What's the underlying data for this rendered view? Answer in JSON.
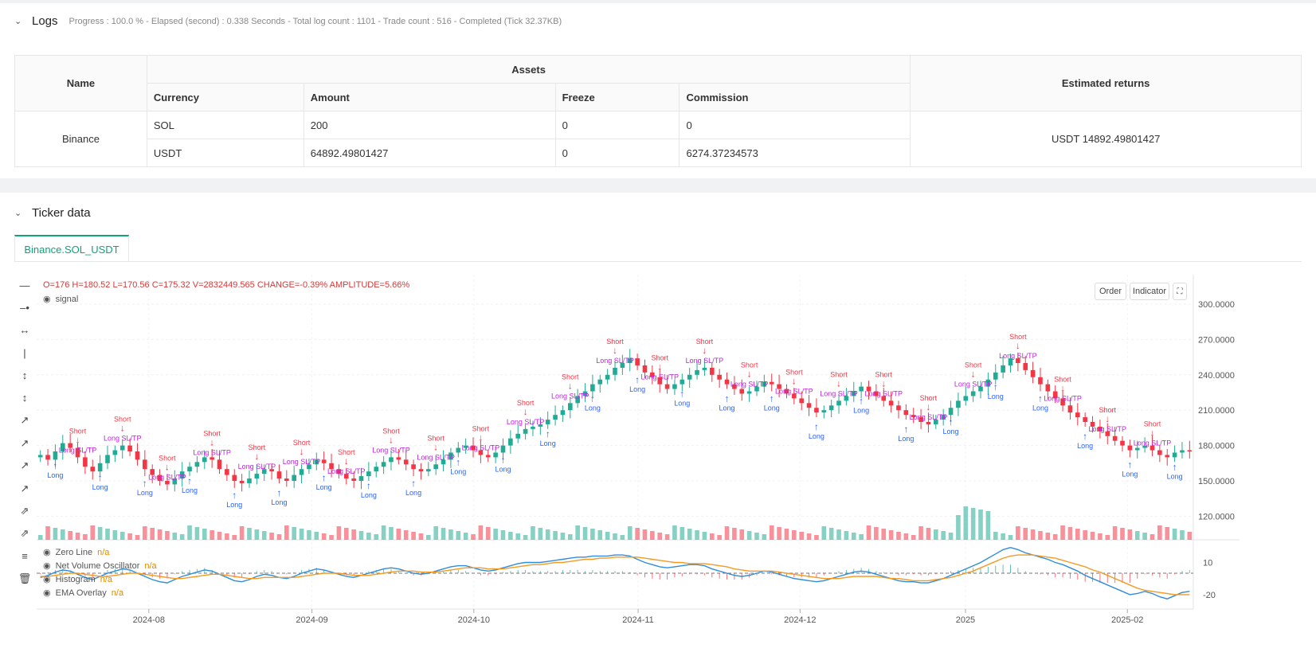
{
  "logs": {
    "title": "Logs",
    "meta": "Progress : 100.0 % - Elapsed (second) : 0.338  Seconds - Total log count : 1101 - Trade count : 516 - Completed (Tick 32.37KB)"
  },
  "assets_table": {
    "name_header": "Name",
    "assets_header": "Assets",
    "returns_header": "Estimated returns",
    "columns": [
      "Currency",
      "Amount",
      "Freeze",
      "Commission"
    ],
    "exchange": "Binance",
    "rows": [
      {
        "currency": "SOL",
        "amount": "200",
        "freeze": "0",
        "commission": "0"
      },
      {
        "currency": "USDT",
        "amount": "64892.49801427",
        "freeze": "0",
        "commission": "6274.37234573"
      }
    ],
    "estimated_returns": "USDT 14892.49801427"
  },
  "ticker": {
    "title": "Ticker data",
    "tab": "Binance.SOL_USDT"
  },
  "chart_header": {
    "ohlc": "O=176 H=180.52 L=170.56 C=175.32 V=2832449.565 CHANGE=-0.39% AMPLITUDE=5.66%",
    "signal": "signal",
    "order_btn": "Order",
    "indicator_btn": "Indicator"
  },
  "indicators": [
    {
      "name": "Zero Line",
      "value": "n/a"
    },
    {
      "name": "Net Volume Oscillator",
      "value": "n/a"
    },
    {
      "name": "Histogram",
      "value": "n/a"
    },
    {
      "name": "EMA Overlay",
      "value": "n/a"
    }
  ],
  "colors": {
    "up": "#22ab94",
    "down": "#f23645",
    "long": "#2962ff",
    "short": "#f23645",
    "sltp": "#c020e0",
    "ema": "#f59a23",
    "osc": "#2f8ddb"
  },
  "chart_data": [
    {
      "type": "candlestick",
      "title": "Binance.SOL_USDT",
      "x_ticks": [
        "2024-08",
        "2024-09",
        "2024-10",
        "2024-11",
        "2024-12",
        "2025",
        "2025-02"
      ],
      "y_ticks": [
        "300.0000",
        "270.0000",
        "240.0000",
        "210.0000",
        "180.0000",
        "150.0000",
        "120.0000"
      ],
      "ylim": [
        100,
        325
      ],
      "close_series": [
        172,
        168,
        175,
        182,
        178,
        170,
        162,
        158,
        165,
        172,
        176,
        180,
        175,
        168,
        160,
        155,
        150,
        147,
        152,
        158,
        162,
        166,
        170,
        168,
        160,
        155,
        150,
        148,
        152,
        156,
        160,
        158,
        152,
        150,
        155,
        160,
        164,
        168,
        165,
        160,
        156,
        152,
        150,
        154,
        158,
        162,
        166,
        170,
        168,
        164,
        160,
        158,
        160,
        164,
        168,
        174,
        178,
        180,
        176,
        172,
        170,
        174,
        180,
        186,
        190,
        194,
        196,
        198,
        202,
        206,
        210,
        216,
        222,
        226,
        232,
        236,
        240,
        246,
        250,
        254,
        248,
        242,
        238,
        232,
        228,
        232,
        236,
        240,
        244,
        246,
        240,
        236,
        232,
        228,
        224,
        226,
        230,
        234,
        232,
        228,
        224,
        220,
        216,
        212,
        208,
        210,
        214,
        218,
        222,
        226,
        230,
        226,
        222,
        218,
        214,
        210,
        206,
        204,
        200,
        198,
        202,
        206,
        212,
        218,
        222,
        226,
        230,
        236,
        242,
        248,
        254,
        250,
        244,
        238,
        232,
        226,
        220,
        214,
        208,
        204,
        200,
        196,
        192,
        188,
        184,
        180,
        176,
        178,
        180,
        176,
        172,
        170,
        174,
        176,
        175
      ]
    },
    {
      "type": "line",
      "title": "Net Volume Oscillator",
      "y_ticks": [
        "10",
        "-20"
      ],
      "ylim": [
        -32,
        26
      ],
      "oscillator": [
        -4,
        -2,
        1,
        3,
        2,
        -1,
        -4,
        -6,
        -3,
        0,
        2,
        4,
        3,
        0,
        -3,
        -6,
        -8,
        -9,
        -6,
        -3,
        -1,
        1,
        3,
        2,
        -1,
        -4,
        -7,
        -8,
        -6,
        -3,
        -1,
        -2,
        -4,
        -5,
        -3,
        0,
        2,
        4,
        3,
        1,
        -1,
        -3,
        -4,
        -2,
        0,
        2,
        4,
        5,
        4,
        2,
        0,
        -1,
        0,
        2,
        4,
        6,
        7,
        7,
        5,
        3,
        2,
        3,
        5,
        7,
        9,
        10,
        10,
        10,
        11,
        12,
        13,
        14,
        15,
        15,
        16,
        16,
        16,
        17,
        17,
        16,
        13,
        10,
        8,
        6,
        5,
        6,
        7,
        8,
        8,
        7,
        4,
        2,
        0,
        -2,
        -3,
        -2,
        0,
        2,
        1,
        -1,
        -3,
        -5,
        -6,
        -7,
        -8,
        -7,
        -5,
        -3,
        -1,
        1,
        2,
        1,
        -1,
        -3,
        -5,
        -7,
        -8,
        -8,
        -9,
        -9,
        -7,
        -5,
        -2,
        1,
        4,
        7,
        10,
        14,
        18,
        22,
        24,
        22,
        19,
        17,
        15,
        13,
        10,
        8,
        5,
        2,
        -2,
        -5,
        -8,
        -11,
        -14,
        -17,
        -20,
        -19,
        -17,
        -19,
        -22,
        -24,
        -21,
        -18,
        -17
      ],
      "ema": [
        -3,
        -3,
        -2,
        -1,
        0,
        0,
        -1,
        -2,
        -3,
        -3,
        -2,
        -1,
        0,
        0,
        -1,
        -2,
        -3,
        -4,
        -5,
        -5,
        -4,
        -3,
        -2,
        -1,
        -1,
        -2,
        -3,
        -4,
        -5,
        -5,
        -4,
        -4,
        -4,
        -4,
        -4,
        -3,
        -2,
        -1,
        0,
        0,
        0,
        -1,
        -2,
        -2,
        -2,
        -1,
        0,
        1,
        2,
        2,
        2,
        1,
        1,
        1,
        2,
        3,
        4,
        5,
        5,
        5,
        4,
        4,
        4,
        5,
        6,
        7,
        8,
        8,
        9,
        10,
        10,
        11,
        12,
        13,
        13,
        14,
        14,
        15,
        15,
        15,
        15,
        14,
        13,
        12,
        11,
        10,
        10,
        9,
        9,
        9,
        8,
        7,
        6,
        4,
        3,
        2,
        2,
        2,
        2,
        1,
        0,
        -1,
        -2,
        -3,
        -4,
        -5,
        -5,
        -5,
        -4,
        -3,
        -3,
        -3,
        -3,
        -4,
        -5,
        -5,
        -6,
        -7,
        -7,
        -7,
        -6,
        -5,
        -4,
        -2,
        0,
        2,
        5,
        8,
        11,
        14,
        16,
        17,
        17,
        17,
        16,
        15,
        14,
        12,
        10,
        8,
        6,
        3,
        1,
        -2,
        -5,
        -8,
        -11,
        -14,
        -16,
        -17,
        -18,
        -19,
        -20,
        -20,
        -20
      ]
    }
  ]
}
